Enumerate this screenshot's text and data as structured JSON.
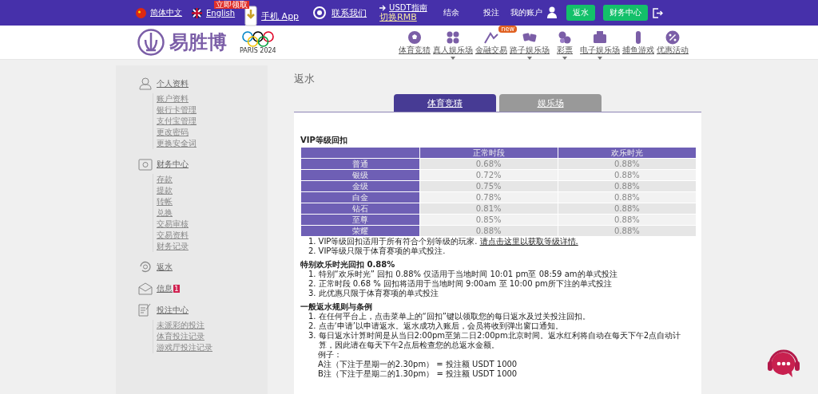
{
  "top_bar": {
    "languages": [
      {
        "label": "简体中文",
        "kind": "cn"
      },
      {
        "label": "English",
        "kind": "uk"
      }
    ],
    "app_badge": "立即领取",
    "app_link": "手机 App",
    "contact_link": "联系我们",
    "usdt_guide": "USDT指南",
    "currency_switch": "切换RMB",
    "balance_label": "结余",
    "bets_label": "投注",
    "account_label": "我的账户",
    "buttons": [
      "返水",
      "财务中心"
    ]
  },
  "nav": {
    "logo": "易胜博",
    "olympics": "PARIS 2024",
    "items": [
      {
        "label": "体育竞猜",
        "caret": false
      },
      {
        "label": "真人娱乐场",
        "caret": true
      },
      {
        "label": "金融交易",
        "caret": false,
        "badge": "new"
      },
      {
        "label": "路子娱乐场",
        "caret": true
      },
      {
        "label": "彩票",
        "caret": true
      },
      {
        "label": "电子娱乐场",
        "caret": true
      },
      {
        "label": "捕鱼游戏",
        "caret": false
      },
      {
        "label": "优惠活动",
        "caret": false
      }
    ]
  },
  "sidebar": {
    "sections": [
      {
        "title": "个人资料",
        "children": [
          {
            "label": "账户资料"
          },
          {
            "label": "银行卡管理"
          },
          {
            "label": "支付宝管理"
          },
          {
            "label": "更改密码"
          },
          {
            "label": "更换安全词"
          }
        ]
      },
      {
        "title": "财务中心",
        "children": [
          {
            "label": "存款"
          },
          {
            "label": "提款"
          },
          {
            "label": "转帐"
          },
          {
            "label": "兑换"
          },
          {
            "label": "交易审核"
          },
          {
            "label": "交易资料"
          },
          {
            "label": "财务记录"
          }
        ]
      },
      {
        "title": "返水"
      },
      {
        "title": "信息",
        "badge": "1"
      },
      {
        "title": "投注中心",
        "children": [
          {
            "label": "未派彩的投注"
          },
          {
            "label": "体育投注记录"
          },
          {
            "label": "游戏厅投注记录"
          }
        ]
      }
    ]
  },
  "page_title": "返水",
  "tabs": [
    {
      "label": "体育竞猜",
      "selected": true
    },
    {
      "label": "娱乐场",
      "selected": false
    }
  ],
  "vip": {
    "heading": "VIP等级回扣",
    "columns": [
      "正常时段",
      "欢乐时光"
    ],
    "rows": [
      {
        "level": "普通",
        "normal": "0.68%",
        "happy": "0.88%"
      },
      {
        "level": "银级",
        "normal": "0.72%",
        "happy": "0.88%"
      },
      {
        "level": "金级",
        "normal": "0.75%",
        "happy": "0.88%"
      },
      {
        "level": "白金",
        "normal": "0.78%",
        "happy": "0.88%"
      },
      {
        "level": "钻石",
        "normal": "0.81%",
        "happy": "0.88%"
      },
      {
        "level": "至尊",
        "normal": "0.85%",
        "happy": "0.88%"
      },
      {
        "level": "荣耀",
        "normal": "0.88%",
        "happy": "0.88%"
      }
    ],
    "notes": [
      {
        "number": "1.",
        "text": "VIP等级回扣适用于所有符合个别等级的玩家.",
        "link": "请点击这里以获取等级详情."
      },
      {
        "number": "2.",
        "text": "VIP等级只限于体育赛项的单式投注."
      }
    ]
  },
  "happy_hour": {
    "heading": "特别欢乐时光回扣 0.88%",
    "items": [
      {
        "number": "1.",
        "text": "特别“欢乐时光” 回扣 0.88% 仅适用于当地时间 10:01 pm至 08:59 am的单式投注"
      },
      {
        "number": "2.",
        "text": "正常时段 0.68 % 回扣将适用于当地时间 9:00am 至 10:00 pm所下注的单式投注"
      },
      {
        "number": "3.",
        "text": "此优惠只限于体育赛项的单式投注"
      }
    ]
  },
  "rules": {
    "heading": "一般返水规则与条例",
    "items": [
      {
        "number": "1.",
        "text": "在任何平台上，点击菜单上的“回扣”键以领取您的每日返水及过关投注回扣。"
      },
      {
        "number": "2.",
        "text": "点击‘申请’以申请返水。返水成功入账后，会员将收到弹出窗口通知。"
      },
      {
        "number": "3.",
        "text": "每日返水计算时间是从当日2:00pm至第二日2:00pm北京时间。返水红利将自动在每天下午2点自动计算，因此请在每天下午2点后检查您的总返水金额。"
      }
    ],
    "example_label": "例子：",
    "examples": [
      "A注（下注于星期一的2.30pm） = 投注额 USDT 1000",
      "B注（下注于星期二的1.30pm） = 投注额 USDT 1000"
    ]
  }
}
